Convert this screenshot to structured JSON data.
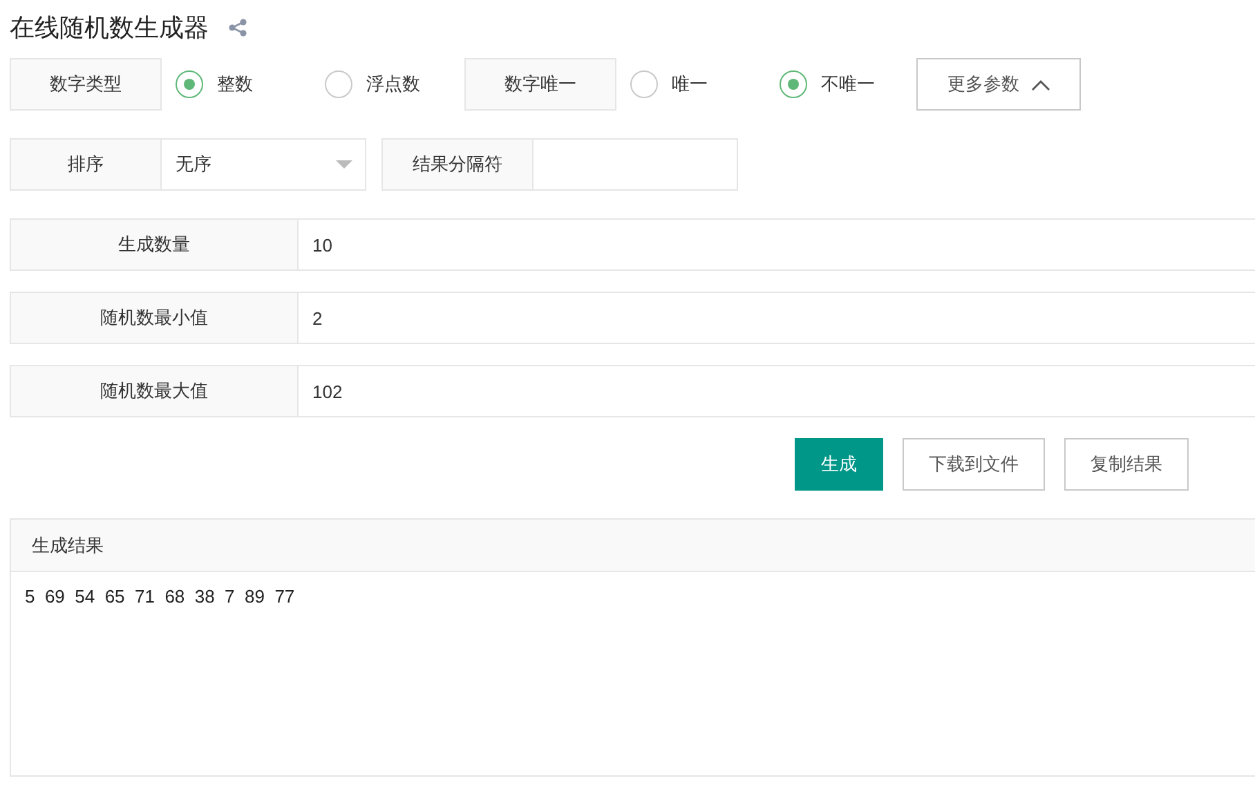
{
  "title": "在线随机数生成器",
  "radio_groups": [
    {
      "label": "数字类型",
      "options": [
        {
          "label": "整数",
          "selected": true
        },
        {
          "label": "浮点数",
          "selected": false
        }
      ]
    },
    {
      "label": "数字唯一",
      "options": [
        {
          "label": "唯一",
          "selected": false
        },
        {
          "label": "不唯一",
          "selected": true
        }
      ]
    }
  ],
  "more_button": {
    "label": "更多参数",
    "expanded": true
  },
  "sort": {
    "label": "排序",
    "value": "无序"
  },
  "separator": {
    "label": "结果分隔符"
  },
  "fields": [
    {
      "label": "生成数量",
      "value": "10"
    },
    {
      "label": "随机数最小值",
      "value": "2"
    },
    {
      "label": "随机数最大值",
      "value": "102"
    }
  ],
  "buttons": [
    {
      "label": "生成",
      "kind": "primary"
    },
    {
      "label": "下载到文件",
      "kind": "default"
    },
    {
      "label": "复制结果",
      "kind": "default"
    }
  ],
  "result": {
    "title": "生成结果",
    "text": "5  69  54  65  71  68  38  7  89  77"
  }
}
